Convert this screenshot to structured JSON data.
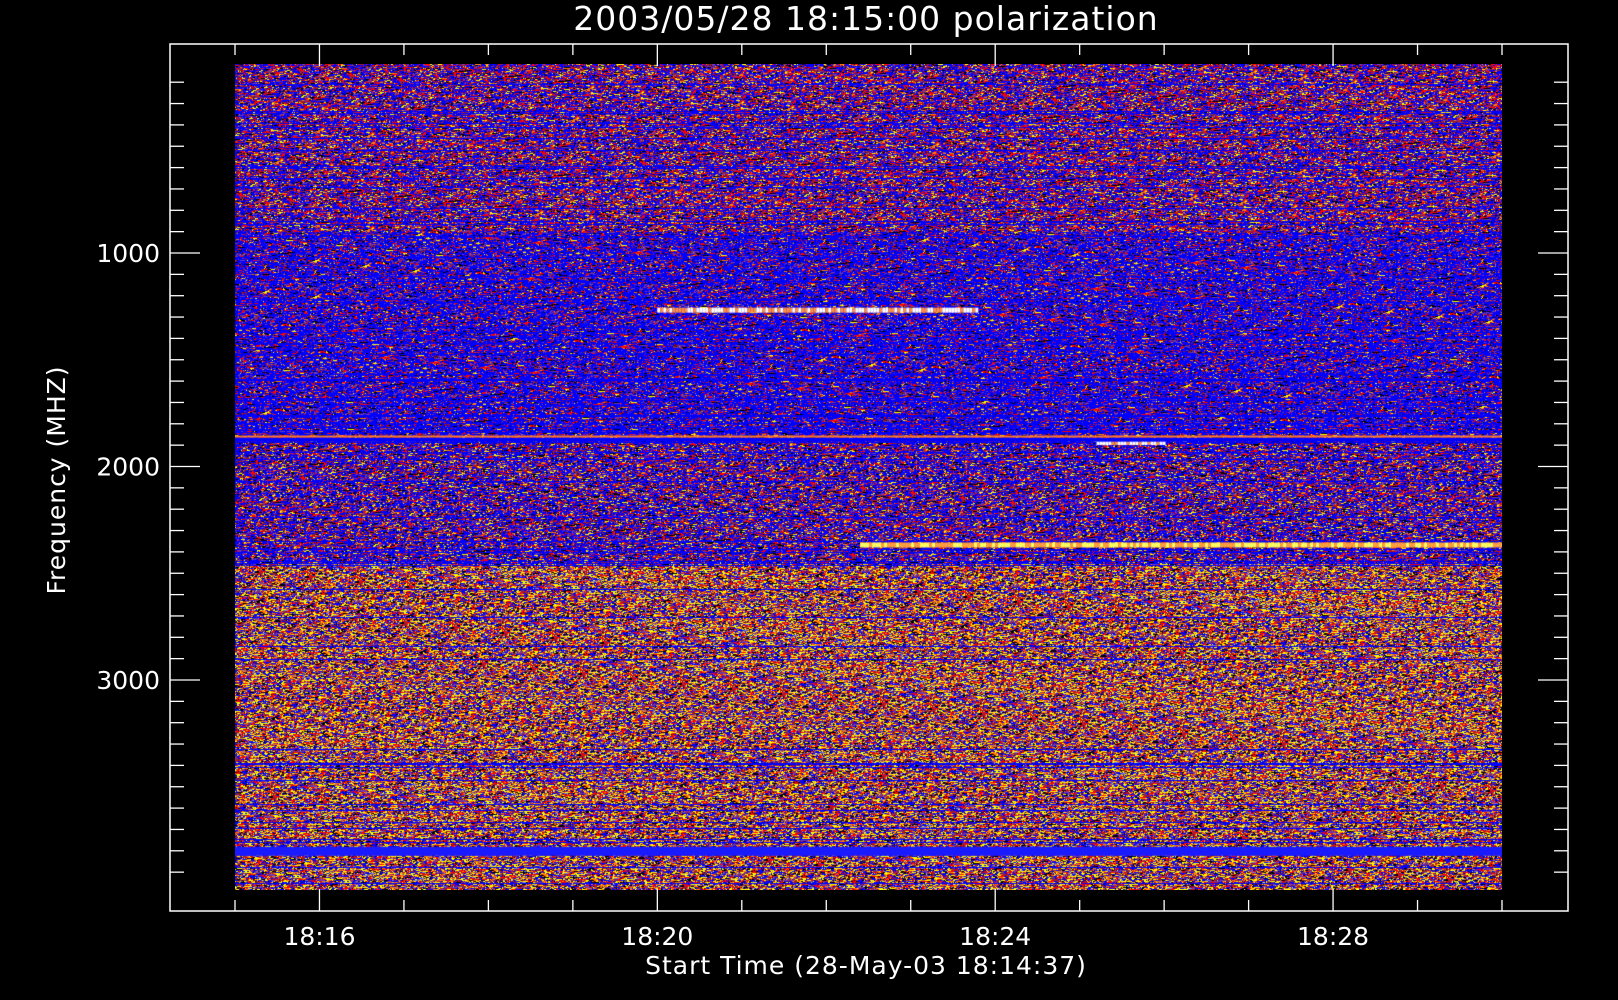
{
  "chart_data": {
    "type": "heatmap",
    "title": "2003/05/28 18:15:00 polarization",
    "xlabel": "Start Time (28-May-03 18:14:37)",
    "ylabel": "Frequency (MHZ)",
    "x_ticks": [
      "18:16",
      "18:20",
      "18:24",
      "18:28"
    ],
    "x_tick_minutes": [
      16,
      20,
      24,
      28
    ],
    "x_range_minutes": [
      15,
      30
    ],
    "y_ticks": [
      1000,
      2000,
      3000
    ],
    "ylim": [
      3950,
      100
    ],
    "y_inverted": true,
    "colormap": [
      "#000000",
      "#0000ff",
      "#ff0000",
      "#ff8000",
      "#ffff00",
      "#ffffff"
    ],
    "bands": [
      {
        "from": 100,
        "to": 900,
        "style": "mixed blue-red with yellow speckles"
      },
      {
        "from": 900,
        "to": 1850,
        "style": "predominantly blue with red/orange speckles"
      },
      {
        "from": 1850,
        "to": 2450,
        "style": "blue with red/yellow"
      },
      {
        "from": 2450,
        "to": 3950,
        "style": "mixed yellow, orange, red and blue"
      }
    ],
    "features": [
      {
        "freq": 1270,
        "t_start": 20.0,
        "t_end": 23.8,
        "color": "white/orange"
      },
      {
        "freq": 1890,
        "t_start": 25.2,
        "t_end": 26.0,
        "color": "white"
      },
      {
        "freq": 2370,
        "t_start": 22.4,
        "t_end": 30.0,
        "color": "orange/yellow"
      },
      {
        "freq": 3800,
        "t_start": 15.0,
        "t_end": 30.0,
        "color": "blue"
      }
    ]
  }
}
